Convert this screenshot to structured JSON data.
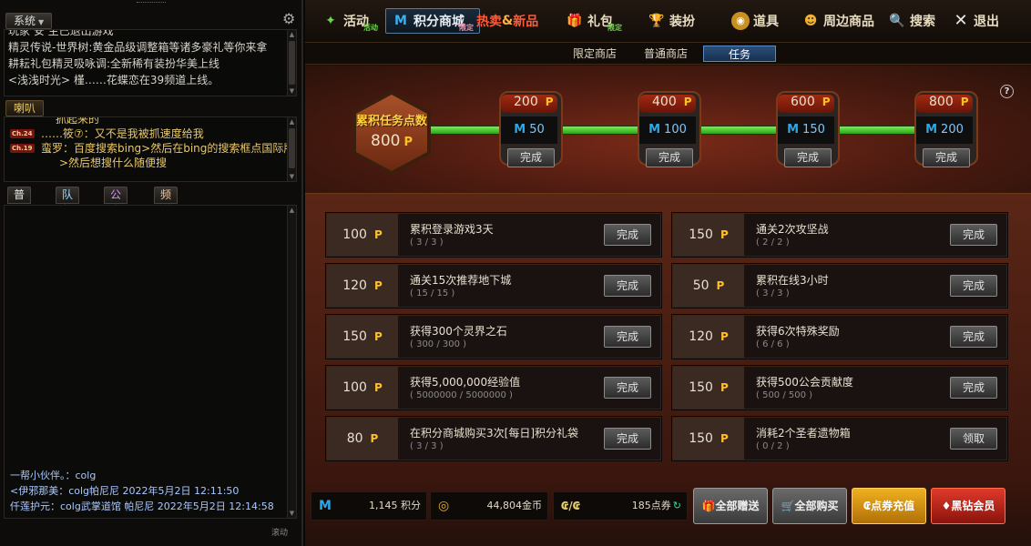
{
  "chat": {
    "system_label": "系统",
    "system_lines": [
      "玩家 安    生已退出游戏",
      "精灵传说-世界树:黄金品级调整箱等诸多豪礼等你来拿",
      "耕耘礼包精灵吸咏调:全新稀有装扮华美上线",
      "<浅浅时光> 槿……花蝶恋在39频道上线。"
    ],
    "horn_label": "喇叭",
    "horn_lines": [
      {
        "ch": "",
        "text": "抓起来的"
      },
      {
        "ch": "Ch.24",
        "text": "……筱⑦：又不是我被抓速度给我"
      },
      {
        "ch": "Ch.19",
        "text": "蛮罗：百度搜索bing>然后在bing的搜索框点国际版"
      },
      {
        "ch": "",
        "text": ">然后想搜什么随便搜"
      }
    ],
    "tabs": [
      "普通",
      "队伍",
      "公会",
      "频道"
    ],
    "messages": [
      "一帮小伙伴。：colg",
      "<伊邪那美：colg帕尼尼 2022年5月2日 12:11:50",
      "仟莲护元：colg武掌道馆 帕尼尼 2022年5月2日 12:14:58"
    ],
    "footer": "滚动"
  },
  "nav": {
    "items": [
      {
        "label": "活动",
        "sub": "活动"
      },
      {
        "label": "积分商城",
        "sub": "限定"
      },
      {
        "label": "热卖&新品",
        "sub": ""
      },
      {
        "label": "礼包",
        "sub": "限定"
      },
      {
        "label": "装扮",
        "sub": ""
      },
      {
        "label": "道具",
        "sub": ""
      },
      {
        "label": "周边商品",
        "sub": ""
      },
      {
        "label": "搜索",
        "sub": ""
      },
      {
        "label": "退出",
        "sub": ""
      }
    ],
    "hot_main": "热卖",
    "hot_amp": "&",
    "hot_new": "新品"
  },
  "subnav": {
    "tabs": [
      "限定商店",
      "普通商店",
      "任务"
    ],
    "active": "任务"
  },
  "progress": {
    "title": "累积任务点数",
    "current": "800",
    "unit": "P",
    "help": "?",
    "milestones": [
      {
        "points": "200",
        "reward": "50",
        "button": "完成"
      },
      {
        "points": "400",
        "reward": "100",
        "button": "完成"
      },
      {
        "points": "600",
        "reward": "150",
        "button": "完成"
      },
      {
        "points": "800",
        "reward": "200",
        "button": "完成"
      }
    ]
  },
  "tasks": {
    "left": [
      {
        "points": "100",
        "name": "累积登录游戏3天",
        "count": "( 3 / 3 )",
        "button": "完成"
      },
      {
        "points": "120",
        "name": "通关15次推荐地下城",
        "count": "( 15 / 15 )",
        "button": "完成"
      },
      {
        "points": "150",
        "name": "获得300个灵界之石",
        "count": "( 300 / 300 )",
        "button": "完成"
      },
      {
        "points": "100",
        "name": "获得5,000,000经验值",
        "count": "( 5000000 / 5000000 )",
        "button": "完成"
      },
      {
        "points": "80",
        "name": "在积分商城购买3次[每日]积分礼袋",
        "count": "( 3 / 3 )",
        "button": "完成"
      }
    ],
    "right": [
      {
        "points": "150",
        "name": "通关2次攻坚战",
        "count": "( 2 / 2 )",
        "button": "完成"
      },
      {
        "points": "50",
        "name": "累积在线3小时",
        "count": "( 3 / 3 )",
        "button": "完成"
      },
      {
        "points": "120",
        "name": "获得6次特殊奖励",
        "count": "( 6 / 6 )",
        "button": "完成"
      },
      {
        "points": "150",
        "name": "获得500公会贡献度",
        "count": "( 500 / 500 )",
        "button": "完成"
      },
      {
        "points": "150",
        "name": "消耗2个圣者遗物箱",
        "count": "( 0 / 2 )",
        "button": "领取"
      }
    ]
  },
  "wallet": {
    "points": "1,145 积分",
    "gold": "44,804金币",
    "coupons": "185点券",
    "coupon_icon_text": "₢/₢"
  },
  "actions": {
    "gift_all": "全部赠送",
    "buy_all": "全部购买",
    "recharge": "点券充值",
    "vip": "黑钻会员"
  },
  "colors": {
    "accent_gold": "#ffc020",
    "progress_green": "#3ac828",
    "active_tab": "#2a4e7a"
  }
}
